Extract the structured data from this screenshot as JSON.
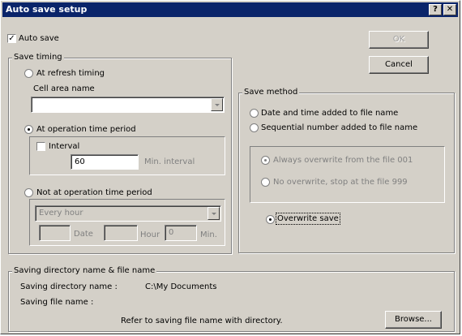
{
  "window": {
    "title": "Auto save setup",
    "help_glyph": "?",
    "close_glyph": "✕"
  },
  "auto_save": {
    "label": "Auto save",
    "checked": true
  },
  "buttons": {
    "ok": "OK",
    "cancel": "Cancel",
    "browse": "Browse..."
  },
  "save_timing": {
    "legend": "Save timing",
    "at_refresh": "At refresh timing",
    "cell_area_label": "Cell area name",
    "cell_area_value": "",
    "at_operation": "At operation time period",
    "interval_label": "Interval",
    "interval_value": "60",
    "min_interval_label": "Min. interval",
    "not_at_operation": "Not at operation time period",
    "every_select": "Every hour",
    "date_label": "Date",
    "hour_label": "Hour",
    "min_value": "0",
    "min_label": "Min."
  },
  "save_method": {
    "legend": "Save method",
    "date_time": "Date and time added to file name",
    "sequential": "Sequential number added to file name",
    "always_overwrite": "Always overwrite from the file 001",
    "no_overwrite": "No overwrite, stop at the file 999",
    "overwrite_save": "Overwrite save"
  },
  "saving": {
    "legend": "Saving directory name & file name",
    "dir_label": "Saving directory name :",
    "dir_value": "C:\\My Documents",
    "file_label": "Saving file name :",
    "refer_text": "Refer to saving file name with directory."
  }
}
